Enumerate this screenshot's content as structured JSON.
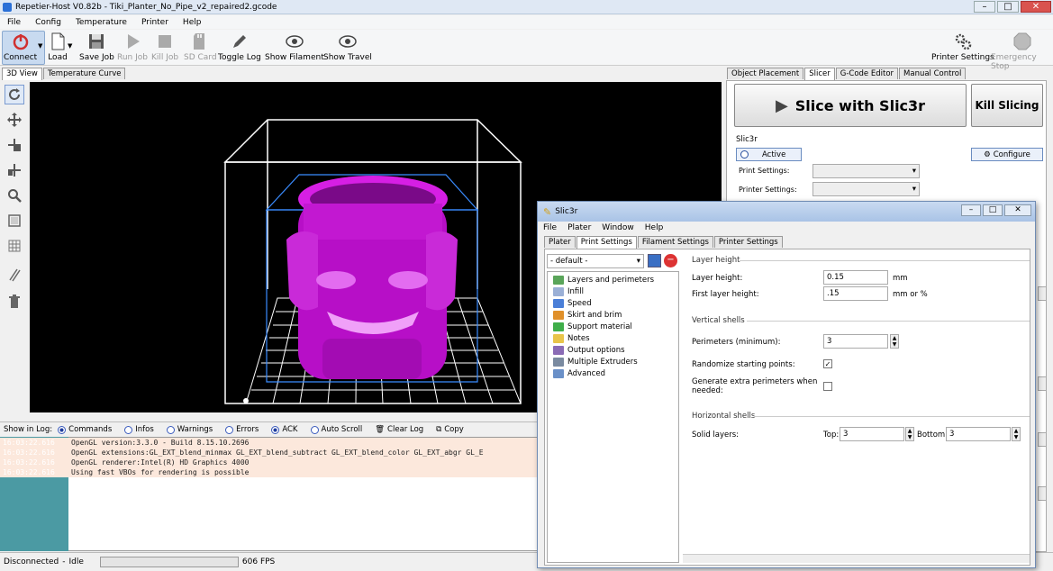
{
  "window": {
    "title": "Repetier-Host V0.82b - Tiki_Planter_No_Pipe_v2_repaired2.gcode"
  },
  "menu": [
    "File",
    "Config",
    "Temperature",
    "Printer",
    "Help"
  ],
  "toolbar": {
    "connect": "Connect",
    "load": "Load",
    "save_job": "Save Job",
    "run_job": "Run Job",
    "kill_job": "Kill Job",
    "sd_card": "SD Card",
    "toggle_log": "Toggle Log",
    "show_filament": "Show Filament",
    "show_travel": "Show Travel",
    "printer_settings": "Printer Settings",
    "emergency_stop": "Emergency Stop"
  },
  "left_tabs": [
    "3D View",
    "Temperature Curve"
  ],
  "log": {
    "show_in_log": "Show in Log:",
    "filters": [
      "Commands",
      "Infos",
      "Warnings",
      "Errors",
      "ACK"
    ],
    "auto_scroll": "Auto Scroll",
    "clear_log": "Clear Log",
    "copy": "Copy",
    "lines": [
      {
        "time": "16:03:22.616",
        "msg": "OpenGL version:3.3.0 - Build 8.15.10.2696"
      },
      {
        "time": "16:03:22.616",
        "msg": "OpenGL extensions:GL_EXT_blend_minmax GL_EXT_blend_subtract GL_EXT_blend_color GL_EXT_abgr GL_E"
      },
      {
        "time": "16:03:22.616",
        "msg": "OpenGL renderer:Intel(R) HD Graphics 4000"
      },
      {
        "time": "16:03:22.616",
        "msg": "Using fast VBOs for rendering is possible"
      }
    ]
  },
  "status": {
    "connection": "Disconnected",
    "state": "Idle",
    "fps": "606 FPS"
  },
  "right_tabs": [
    "Object Placement",
    "Slicer",
    "G-Code Editor",
    "Manual Control"
  ],
  "slicer": {
    "slice_button": "Slice with Slic3r",
    "kill_button": "Kill Slicing",
    "group_label": "Slic3r",
    "active": "Active",
    "configure": "Configure",
    "print_settings": "Print Settings:",
    "printer_settings": "Printer Settings:"
  },
  "slic3r": {
    "title": "Slic3r",
    "menu": [
      "File",
      "Plater",
      "Window",
      "Help"
    ],
    "tabs": [
      "Plater",
      "Print Settings",
      "Filament Settings",
      "Printer Settings"
    ],
    "preset": "- default -",
    "tree": [
      {
        "label": "Layers and perimeters",
        "color": "#5aa55a"
      },
      {
        "label": "Infill",
        "color": "#9bb0d6"
      },
      {
        "label": "Speed",
        "color": "#4a7fd8"
      },
      {
        "label": "Skirt and brim",
        "color": "#e0902a"
      },
      {
        "label": "Support material",
        "color": "#3fae4a"
      },
      {
        "label": "Notes",
        "color": "#e8c44a"
      },
      {
        "label": "Output options",
        "color": "#8a6bb5"
      },
      {
        "label": "Multiple Extruders",
        "color": "#7a8aa0"
      },
      {
        "label": "Advanced",
        "color": "#6a90c8"
      }
    ],
    "layer_height_section": "Layer height",
    "layer_height_label": "Layer height:",
    "layer_height_value": "0.15",
    "layer_height_unit": "mm",
    "first_layer_label": "First layer height:",
    "first_layer_value": ".15",
    "first_layer_unit": "mm or %",
    "vertical_section": "Vertical shells",
    "perimeters_label": "Perimeters (minimum):",
    "perimeters_value": "3",
    "randomize_label": "Randomize starting points:",
    "extra_perimeters_label": "Generate extra perimeters when needed:",
    "horizontal_section": "Horizontal shells",
    "solid_layers_label": "Solid layers:",
    "top_label": "Top:",
    "top_value": "3",
    "bottom_label": "Bottom:",
    "bottom_value": "3"
  }
}
